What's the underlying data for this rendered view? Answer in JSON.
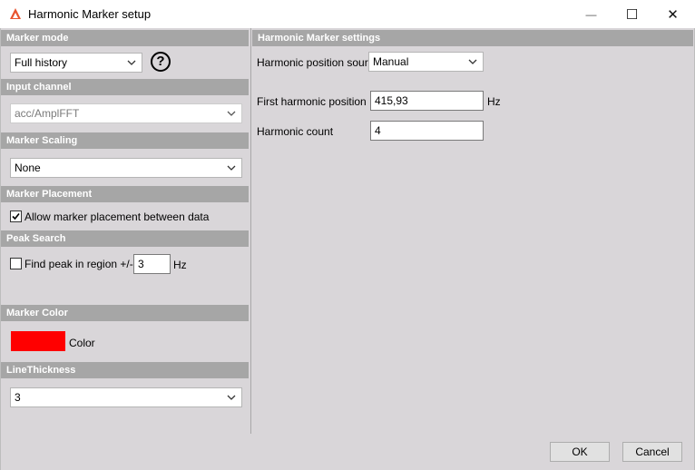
{
  "window": {
    "title": "Harmonic Marker setup",
    "minimize_glyph": "—",
    "maximize_glyph": "☐",
    "close_glyph": "✕"
  },
  "left": {
    "marker_mode": {
      "header": "Marker mode",
      "value": "Full history",
      "help_glyph": "?"
    },
    "input_channel": {
      "header": "Input channel",
      "value": "acc/AmplFFT"
    },
    "marker_scaling": {
      "header": "Marker Scaling",
      "value": "None"
    },
    "marker_placement": {
      "header": "Marker Placement",
      "checkbox_label": "Allow marker placement between data",
      "checked": true
    },
    "peak_search": {
      "header": "Peak Search",
      "checkbox_label": "Find peak in region +/-",
      "checked": false,
      "value": "3",
      "unit": "Hz"
    },
    "marker_color": {
      "header": "Marker Color",
      "swatch_color": "#ff0000",
      "label": "Color"
    },
    "line_thickness": {
      "header": "LineThickness",
      "value": "3"
    }
  },
  "right": {
    "header": "Harmonic Marker settings",
    "position_source": {
      "label": "Harmonic position source",
      "value": "Manual"
    },
    "first_position": {
      "label": "First harmonic position",
      "value": "415,93",
      "unit": "Hz"
    },
    "count": {
      "label": "Harmonic count",
      "value": "4"
    }
  },
  "footer": {
    "ok": "OK",
    "cancel": "Cancel"
  }
}
